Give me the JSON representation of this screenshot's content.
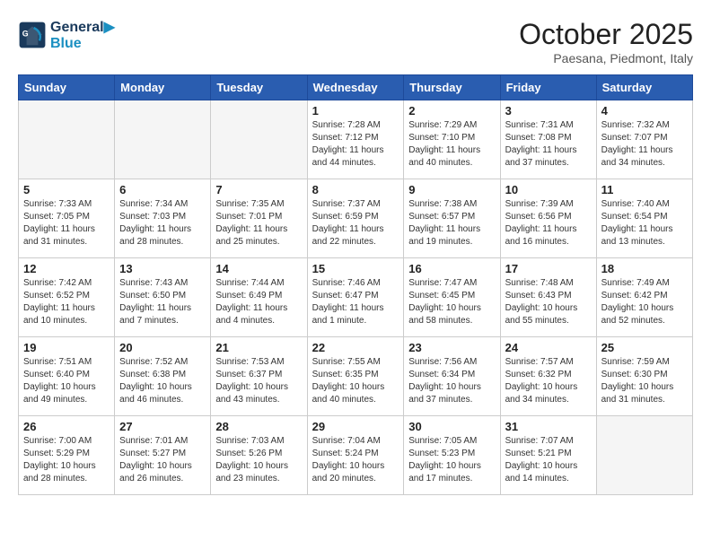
{
  "header": {
    "logo_line1": "General",
    "logo_line2": "Blue",
    "month": "October 2025",
    "location": "Paesana, Piedmont, Italy"
  },
  "weekdays": [
    "Sunday",
    "Monday",
    "Tuesday",
    "Wednesday",
    "Thursday",
    "Friday",
    "Saturday"
  ],
  "weeks": [
    [
      {
        "day": "",
        "info": ""
      },
      {
        "day": "",
        "info": ""
      },
      {
        "day": "",
        "info": ""
      },
      {
        "day": "1",
        "info": "Sunrise: 7:28 AM\nSunset: 7:12 PM\nDaylight: 11 hours and 44 minutes."
      },
      {
        "day": "2",
        "info": "Sunrise: 7:29 AM\nSunset: 7:10 PM\nDaylight: 11 hours and 40 minutes."
      },
      {
        "day": "3",
        "info": "Sunrise: 7:31 AM\nSunset: 7:08 PM\nDaylight: 11 hours and 37 minutes."
      },
      {
        "day": "4",
        "info": "Sunrise: 7:32 AM\nSunset: 7:07 PM\nDaylight: 11 hours and 34 minutes."
      }
    ],
    [
      {
        "day": "5",
        "info": "Sunrise: 7:33 AM\nSunset: 7:05 PM\nDaylight: 11 hours and 31 minutes."
      },
      {
        "day": "6",
        "info": "Sunrise: 7:34 AM\nSunset: 7:03 PM\nDaylight: 11 hours and 28 minutes."
      },
      {
        "day": "7",
        "info": "Sunrise: 7:35 AM\nSunset: 7:01 PM\nDaylight: 11 hours and 25 minutes."
      },
      {
        "day": "8",
        "info": "Sunrise: 7:37 AM\nSunset: 6:59 PM\nDaylight: 11 hours and 22 minutes."
      },
      {
        "day": "9",
        "info": "Sunrise: 7:38 AM\nSunset: 6:57 PM\nDaylight: 11 hours and 19 minutes."
      },
      {
        "day": "10",
        "info": "Sunrise: 7:39 AM\nSunset: 6:56 PM\nDaylight: 11 hours and 16 minutes."
      },
      {
        "day": "11",
        "info": "Sunrise: 7:40 AM\nSunset: 6:54 PM\nDaylight: 11 hours and 13 minutes."
      }
    ],
    [
      {
        "day": "12",
        "info": "Sunrise: 7:42 AM\nSunset: 6:52 PM\nDaylight: 11 hours and 10 minutes."
      },
      {
        "day": "13",
        "info": "Sunrise: 7:43 AM\nSunset: 6:50 PM\nDaylight: 11 hours and 7 minutes."
      },
      {
        "day": "14",
        "info": "Sunrise: 7:44 AM\nSunset: 6:49 PM\nDaylight: 11 hours and 4 minutes."
      },
      {
        "day": "15",
        "info": "Sunrise: 7:46 AM\nSunset: 6:47 PM\nDaylight: 11 hours and 1 minute."
      },
      {
        "day": "16",
        "info": "Sunrise: 7:47 AM\nSunset: 6:45 PM\nDaylight: 10 hours and 58 minutes."
      },
      {
        "day": "17",
        "info": "Sunrise: 7:48 AM\nSunset: 6:43 PM\nDaylight: 10 hours and 55 minutes."
      },
      {
        "day": "18",
        "info": "Sunrise: 7:49 AM\nSunset: 6:42 PM\nDaylight: 10 hours and 52 minutes."
      }
    ],
    [
      {
        "day": "19",
        "info": "Sunrise: 7:51 AM\nSunset: 6:40 PM\nDaylight: 10 hours and 49 minutes."
      },
      {
        "day": "20",
        "info": "Sunrise: 7:52 AM\nSunset: 6:38 PM\nDaylight: 10 hours and 46 minutes."
      },
      {
        "day": "21",
        "info": "Sunrise: 7:53 AM\nSunset: 6:37 PM\nDaylight: 10 hours and 43 minutes."
      },
      {
        "day": "22",
        "info": "Sunrise: 7:55 AM\nSunset: 6:35 PM\nDaylight: 10 hours and 40 minutes."
      },
      {
        "day": "23",
        "info": "Sunrise: 7:56 AM\nSunset: 6:34 PM\nDaylight: 10 hours and 37 minutes."
      },
      {
        "day": "24",
        "info": "Sunrise: 7:57 AM\nSunset: 6:32 PM\nDaylight: 10 hours and 34 minutes."
      },
      {
        "day": "25",
        "info": "Sunrise: 7:59 AM\nSunset: 6:30 PM\nDaylight: 10 hours and 31 minutes."
      }
    ],
    [
      {
        "day": "26",
        "info": "Sunrise: 7:00 AM\nSunset: 5:29 PM\nDaylight: 10 hours and 28 minutes."
      },
      {
        "day": "27",
        "info": "Sunrise: 7:01 AM\nSunset: 5:27 PM\nDaylight: 10 hours and 26 minutes."
      },
      {
        "day": "28",
        "info": "Sunrise: 7:03 AM\nSunset: 5:26 PM\nDaylight: 10 hours and 23 minutes."
      },
      {
        "day": "29",
        "info": "Sunrise: 7:04 AM\nSunset: 5:24 PM\nDaylight: 10 hours and 20 minutes."
      },
      {
        "day": "30",
        "info": "Sunrise: 7:05 AM\nSunset: 5:23 PM\nDaylight: 10 hours and 17 minutes."
      },
      {
        "day": "31",
        "info": "Sunrise: 7:07 AM\nSunset: 5:21 PM\nDaylight: 10 hours and 14 minutes."
      },
      {
        "day": "",
        "info": ""
      }
    ]
  ]
}
